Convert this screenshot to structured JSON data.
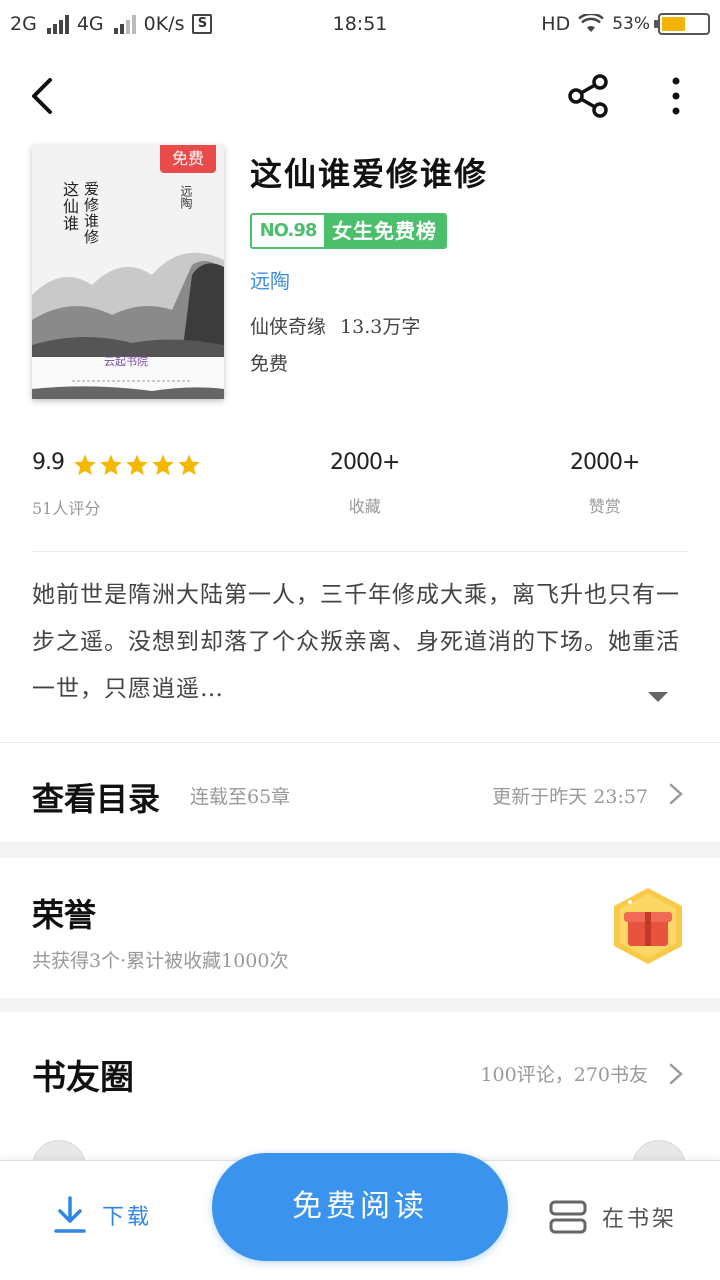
{
  "status_bar": {
    "network1": "2G",
    "network2": "4G",
    "speed": "0K/s",
    "s_icon": "S",
    "time": "18:51",
    "hd": "HD",
    "battery_text": "53%",
    "battery_level": 0.53
  },
  "book": {
    "title": "这仙谁爱修谁修",
    "cover": {
      "free_tag": "免费",
      "title_line1": "这仙谁",
      "title_line2": "爱修谁修",
      "author": "远陶",
      "brand": "云起书院"
    },
    "rank_no": "NO.98",
    "rank_label": "女生免费榜",
    "author": "远陶",
    "genre": "仙侠奇缘",
    "word_count": "13.3万字",
    "price": "免费"
  },
  "stats": {
    "rating": "9.9",
    "stars": 5,
    "rating_label": "51人评分",
    "favorites": "2000+",
    "favorites_label": "收藏",
    "rewards": "2000+",
    "rewards_label": "赞赏"
  },
  "synopsis": {
    "text": "她前世是隋洲大陆第一人，三千年修成大乘，离飞升也只有一步之遥。没想到却落了个众叛亲离、身死道消的下场。她重活一世，只愿逍遥…"
  },
  "toc": {
    "title": "查看目录",
    "status": "连载至65章",
    "updated": "更新于昨天 23:57"
  },
  "honor": {
    "title": "荣誉",
    "desc": "共获得3个·累计被收藏1000次"
  },
  "circle": {
    "title": "书友圈",
    "summary": "100评论，270书友"
  },
  "bottom": {
    "download": "下载",
    "read": "免费阅读",
    "shelf": "在书架"
  },
  "colors": {
    "accent": "#3a93ec",
    "rank_green": "#4cbf6c",
    "free_red": "#e94b4b",
    "star_gold": "#f5b800"
  },
  "icons": [
    "back-icon",
    "share-icon",
    "more-icon",
    "star-icon",
    "chevron-right-icon",
    "chevron-down-icon",
    "download-icon",
    "bookshelf-icon",
    "honor-badge-icon"
  ]
}
